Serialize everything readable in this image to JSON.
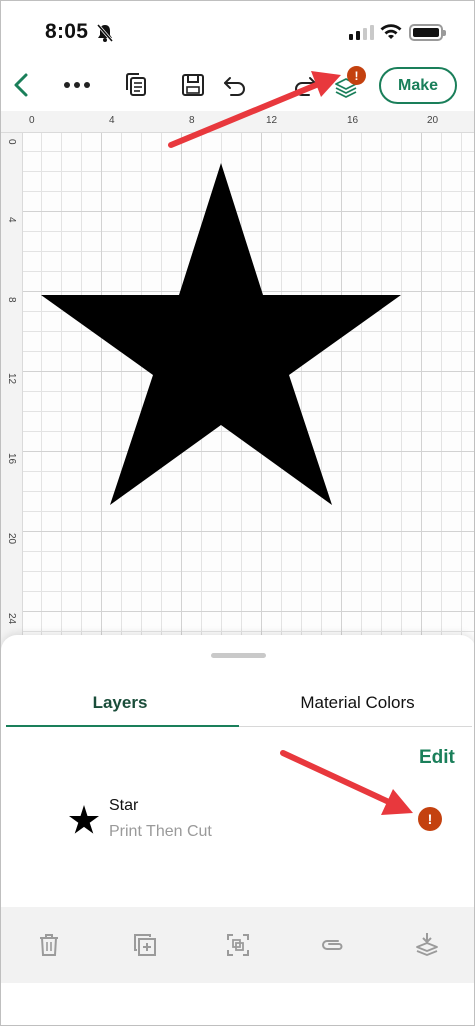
{
  "status_bar": {
    "time": "8:05"
  },
  "toolbar": {
    "make_label": "Make",
    "layers_badge": "!"
  },
  "rulers": {
    "top": [
      "0",
      "4",
      "8",
      "12",
      "16",
      "20"
    ],
    "left": [
      "0",
      "4",
      "8",
      "12",
      "16",
      "20",
      "24"
    ]
  },
  "canvas": {
    "shape_icon": "star-shape",
    "fill": "#000000"
  },
  "sheet": {
    "tabs": [
      {
        "label": "Layers",
        "active": true
      },
      {
        "label": "Material Colors",
        "active": false
      }
    ],
    "edit_label": "Edit",
    "layers": [
      {
        "name": "Star",
        "type": "Print Then Cut",
        "warning": "!"
      }
    ]
  },
  "bottom_bar": {
    "icons": [
      "trash-icon",
      "duplicate-icon",
      "group-icon",
      "attach-icon",
      "flatten-icon"
    ]
  },
  "colors": {
    "accent": "#1a7f5a",
    "warning": "#c4410f",
    "annotation": "#e8383d"
  }
}
